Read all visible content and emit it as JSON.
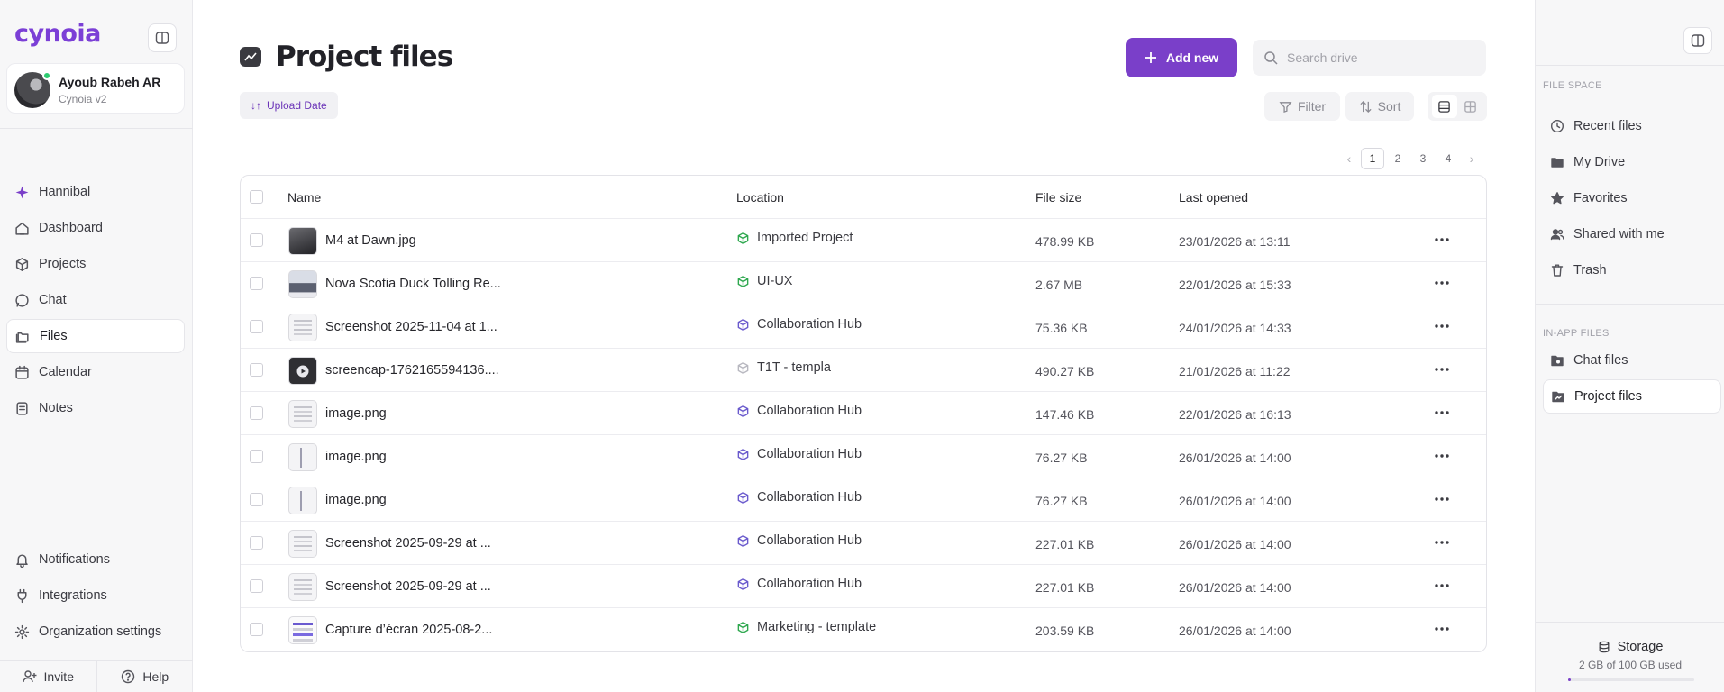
{
  "app": {
    "brand": "cynoia"
  },
  "user": {
    "name": "Ayoub Rabeh AR",
    "subtitle": "Cynoia v2"
  },
  "sidebar": {
    "items": [
      {
        "label": "Hannibal",
        "icon": "sparkle-icon"
      },
      {
        "label": "Dashboard",
        "icon": "home-icon"
      },
      {
        "label": "Projects",
        "icon": "cube-icon"
      },
      {
        "label": "Chat",
        "icon": "chat-icon"
      },
      {
        "label": "Files",
        "icon": "folders-icon",
        "active": true
      },
      {
        "label": "Calendar",
        "icon": "calendar-icon"
      },
      {
        "label": "Notes",
        "icon": "notes-icon"
      }
    ],
    "bottom_items": [
      {
        "label": "Notifications",
        "icon": "bell-icon"
      },
      {
        "label": "Integrations",
        "icon": "plug-icon"
      },
      {
        "label": "Organization settings",
        "icon": "gear-icon"
      }
    ],
    "footer": {
      "invite": "Invite",
      "help": "Help"
    }
  },
  "page": {
    "title": "Project files",
    "add_new": "Add new",
    "search_placeholder": "Search drive",
    "sort_chip": "Upload Date",
    "filter": "Filter",
    "sort": "Sort",
    "view_mode": "list"
  },
  "pagination": {
    "pages": [
      "1",
      "2",
      "3",
      "4"
    ],
    "current": "1"
  },
  "table": {
    "headers": {
      "name": "Name",
      "location": "Location",
      "size": "File size",
      "opened": "Last opened"
    },
    "rows": [
      {
        "name": "M4 at Dawn.jpg",
        "thumb": "dark",
        "location": "Imported Project",
        "loc_color": "#2fa84f",
        "size": "478.99 KB",
        "opened": "23/01/2026 at 13:11"
      },
      {
        "name": "Nova Scotia Duck Tolling Re...",
        "thumb": "photo",
        "location": "UI-UX",
        "loc_color": "#2fa84f",
        "size": "2.67 MB",
        "opened": "22/01/2026 at 15:33"
      },
      {
        "name": "Screenshot 2025-11-04 at 1...",
        "thumb": "doc",
        "location": "Collaboration Hub",
        "loc_color": "#6a5acd",
        "size": "75.36 KB",
        "opened": "24/01/2026 at 14:33"
      },
      {
        "name": "screencap-1762165594136....",
        "thumb": "video",
        "location": "T1T - templa",
        "loc_color": "#b8b8c0",
        "size": "490.27 KB",
        "opened": "21/01/2026 at 11:22"
      },
      {
        "name": "image.png",
        "thumb": "doc",
        "location": "Collaboration Hub",
        "loc_color": "#6a5acd",
        "size": "147.46 KB",
        "opened": "22/01/2026 at 16:13"
      },
      {
        "name": "image.png",
        "thumb": "doc2",
        "location": "Collaboration Hub",
        "loc_color": "#6a5acd",
        "size": "76.27 KB",
        "opened": "26/01/2026 at 14:00"
      },
      {
        "name": "image.png",
        "thumb": "doc2",
        "location": "Collaboration Hub",
        "loc_color": "#6a5acd",
        "size": "76.27 KB",
        "opened": "26/01/2026 at 14:00"
      },
      {
        "name": "Screenshot 2025-09-29 at ...",
        "thumb": "doc",
        "location": "Collaboration Hub",
        "loc_color": "#6a5acd",
        "size": "227.01 KB",
        "opened": "26/01/2026 at 14:00"
      },
      {
        "name": "Screenshot 2025-09-29 at ...",
        "thumb": "doc",
        "location": "Collaboration Hub",
        "loc_color": "#6a5acd",
        "size": "227.01 KB",
        "opened": "26/01/2026 at 14:00"
      },
      {
        "name": "Capture d’écran 2025-08-2...",
        "thumb": "doc3",
        "location": "Marketing - template",
        "loc_color": "#2fa84f",
        "size": "203.59 KB",
        "opened": "26/01/2026 at 14:00"
      }
    ]
  },
  "right_panel": {
    "file_space_label": "FILE SPACE",
    "file_space": [
      {
        "label": "Recent files",
        "icon": "clock-icon"
      },
      {
        "label": "My Drive",
        "icon": "drive-icon"
      },
      {
        "label": "Favorites",
        "icon": "star-icon"
      },
      {
        "label": "Shared with me",
        "icon": "users-icon"
      },
      {
        "label": "Trash",
        "icon": "trash-icon"
      }
    ],
    "in_app_label": "IN-APP FILES",
    "in_app": [
      {
        "label": "Chat files",
        "icon": "chat-folder-icon"
      },
      {
        "label": "Project files",
        "icon": "project-folder-icon",
        "active": true
      }
    ],
    "storage": {
      "title": "Storage",
      "usage": "2 GB of 100 GB used",
      "used_fraction": 0.02
    }
  },
  "colors": {
    "accent": "#7a3fc9",
    "green": "#2fa84f",
    "hub": "#6a5acd"
  }
}
